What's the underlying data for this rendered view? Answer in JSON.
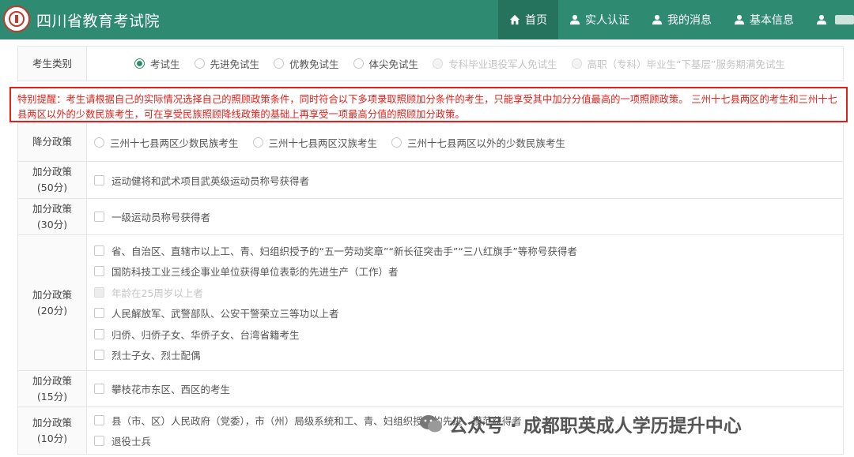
{
  "header": {
    "site_title": "四川省教育考试院",
    "nav": [
      {
        "label": "首页",
        "icon": "home-icon",
        "active": true
      },
      {
        "label": "实人认证",
        "icon": "user-icon"
      },
      {
        "label": "我的消息",
        "icon": "user-icon"
      },
      {
        "label": "基本信息",
        "icon": "user-icon"
      }
    ]
  },
  "exam_category": {
    "label": "考生类别",
    "options": [
      {
        "label": "考试生",
        "checked": true
      },
      {
        "label": "先进免试生"
      },
      {
        "label": "优教免试生"
      },
      {
        "label": "体尖免试生"
      },
      {
        "label": "专科毕业退役军人免试生",
        "disabled": true
      },
      {
        "label": "高职（专科）毕业生“下基层”服务期满免试生",
        "disabled": true
      }
    ]
  },
  "notice": "特别提醒：考生请根据自己的实际情况选择自己的照顾政策条件，同时符合以下多项录取照顾加分条件的考生，只能享受其中加分分值最高的一项照顾政策。 三州十七县两区的考生和三州十七县两区以外的少数民族考生，可在享受民族照顾降线政策的基础上再享受一项最高分值的照顾加分政策。",
  "reduce_policy": {
    "label": "降分政策",
    "options": [
      "三州十七县两区少数民族考生",
      "三州十七县两区汉族考生",
      "三州十七县两区以外的少数民族考生"
    ]
  },
  "bonus_groups": [
    {
      "label": "加分政策",
      "points": "(50分)",
      "items": [
        {
          "text": "运动健将和武术项目武英级运动员称号获得者"
        }
      ]
    },
    {
      "label": "加分政策",
      "points": "(30分)",
      "items": [
        {
          "text": "一级运动员称号获得者"
        }
      ]
    },
    {
      "label": "加分政策",
      "points": "(20分)",
      "items": [
        {
          "text": "省、自治区、直辖市以上工、青、妇组织授予的“五一劳动奖章”“新长征突击手”“三八红旗手”等称号获得者"
        },
        {
          "text": "国防科技工业三线企事业单位获得单位表彰的先进生产（工作）者"
        },
        {
          "text": "年龄在25周岁以上者",
          "disabled": true
        },
        {
          "text": "人民解放军、武警部队、公安干警荣立三等功以上者"
        },
        {
          "text": "归侨、归侨子女、华侨子女、台湾省籍考生"
        },
        {
          "text": "烈士子女、烈士配偶"
        }
      ]
    },
    {
      "label": "加分政策",
      "points": "(15分)",
      "items": [
        {
          "text": "攀枝花市东区、西区的考生"
        }
      ]
    },
    {
      "label": "加分政策",
      "points": "(10分)",
      "items": [
        {
          "text": "县（市、区）人民政府（党委），市（州）局级系统和工、青、妇组织授予的先进、模范获得者"
        },
        {
          "text": "退役士兵"
        }
      ]
    }
  ],
  "watermark": "公众号 · 成都职英成人学历提升中心"
}
